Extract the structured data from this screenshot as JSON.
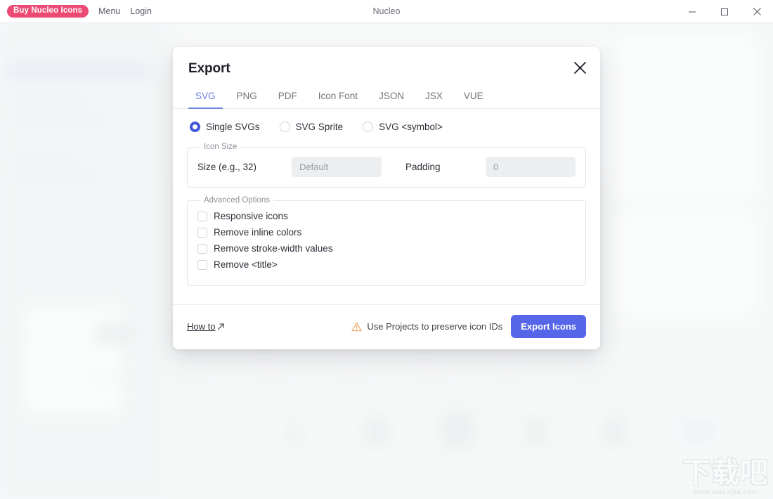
{
  "titlebar": {
    "buy_badge": "Buy Nucleo Icons",
    "menu": "Menu",
    "login": "Login",
    "app_title": "Nucleo",
    "minimize_icon": "minimize-icon",
    "maximize_icon": "maximize-icon",
    "close_icon": "close-icon"
  },
  "modal": {
    "title": "Export",
    "close_icon": "close-icon",
    "tabs": [
      {
        "label": "SVG",
        "active": true
      },
      {
        "label": "PNG",
        "active": false
      },
      {
        "label": "PDF",
        "active": false
      },
      {
        "label": "Icon Font",
        "active": false
      },
      {
        "label": "JSON",
        "active": false
      },
      {
        "label": "JSX",
        "active": false
      },
      {
        "label": "VUE",
        "active": false
      }
    ],
    "export_mode": {
      "selected": "Single SVGs",
      "options": [
        {
          "label": "Single SVGs",
          "selected": true
        },
        {
          "label": "SVG Sprite",
          "selected": false
        },
        {
          "label": "SVG <symbol>",
          "selected": false
        }
      ]
    },
    "icon_size": {
      "legend": "Icon Size",
      "size_label": "Size (e.g., 32)",
      "size_value": "",
      "size_placeholder": "Default",
      "padding_label": "Padding",
      "padding_value": "",
      "padding_placeholder": "0"
    },
    "advanced": {
      "legend": "Advanced Options",
      "options": [
        {
          "label": "Responsive icons",
          "checked": false
        },
        {
          "label": "Remove inline colors",
          "checked": false
        },
        {
          "label": "Remove stroke-width values",
          "checked": false
        },
        {
          "label": "Remove <title>",
          "checked": false
        }
      ]
    },
    "footer": {
      "howto_label": "How to",
      "howto_icon": "external-link-arrow-icon",
      "warning_icon": "warning-triangle-icon",
      "warning_text": "Use Projects to preserve icon IDs",
      "export_button": "Export Icons"
    }
  },
  "watermark": {
    "logo_text": "下载吧",
    "url": "www.xiazaiba.com"
  },
  "colors": {
    "accent_blue": "#5766e8",
    "tab_active": "#6a7fe0",
    "badge_pink": "#ec4a73",
    "warning_orange": "#efb077",
    "window_bg": "#f2f3f5"
  }
}
